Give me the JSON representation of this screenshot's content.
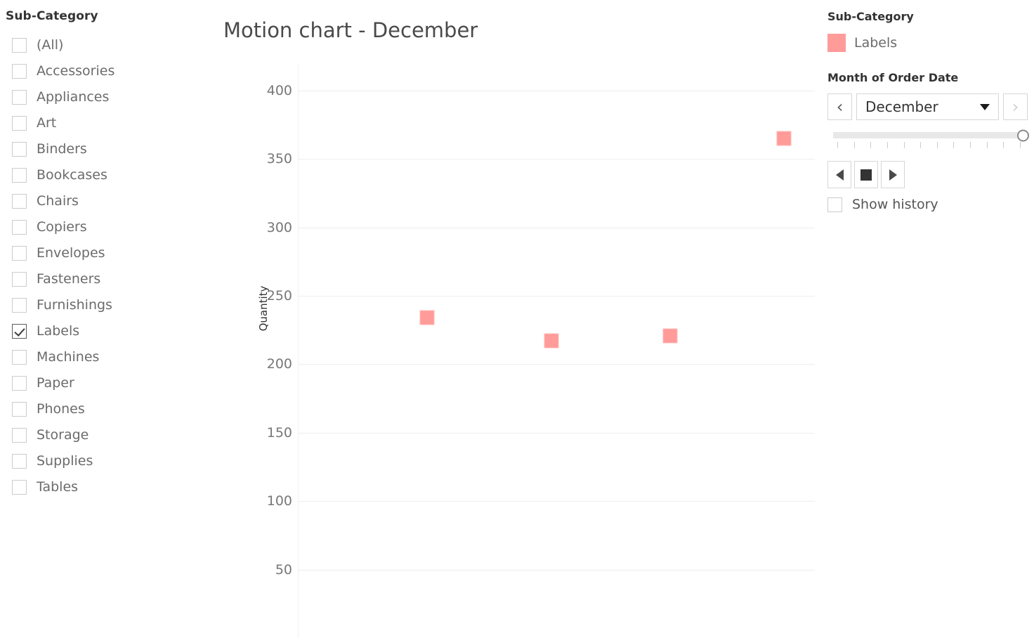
{
  "sidebar": {
    "title": "Sub-Category",
    "items": [
      {
        "label": "(All)",
        "checked": false
      },
      {
        "label": "Accessories",
        "checked": false
      },
      {
        "label": "Appliances",
        "checked": false
      },
      {
        "label": "Art",
        "checked": false
      },
      {
        "label": "Binders",
        "checked": false
      },
      {
        "label": "Bookcases",
        "checked": false
      },
      {
        "label": "Chairs",
        "checked": false
      },
      {
        "label": "Copiers",
        "checked": false
      },
      {
        "label": "Envelopes",
        "checked": false
      },
      {
        "label": "Fasteners",
        "checked": false
      },
      {
        "label": "Furnishings",
        "checked": false
      },
      {
        "label": "Labels",
        "checked": true
      },
      {
        "label": "Machines",
        "checked": false
      },
      {
        "label": "Paper",
        "checked": false
      },
      {
        "label": "Phones",
        "checked": false
      },
      {
        "label": "Storage",
        "checked": false
      },
      {
        "label": "Supplies",
        "checked": false
      },
      {
        "label": "Tables",
        "checked": false
      }
    ]
  },
  "chart_data": {
    "type": "scatter",
    "title": "Motion chart - December",
    "xlabel": "",
    "ylabel": "Quantity",
    "ylim": [
      0,
      420
    ],
    "yticks": [
      400,
      350,
      300,
      250,
      200,
      150,
      100,
      50
    ],
    "grid": true,
    "legend_position": "right",
    "mark_shape": "square",
    "mark_color": "#ff9b99",
    "series": [
      {
        "name": "Labels",
        "color": "#ff9b99",
        "points": [
          {
            "x": 0.25,
            "y": 234
          },
          {
            "x": 0.49,
            "y": 217
          },
          {
            "x": 0.72,
            "y": 221
          },
          {
            "x": 0.94,
            "y": 365
          }
        ]
      }
    ]
  },
  "right_panel": {
    "legend_title": "Sub-Category",
    "legend_items": [
      {
        "label": "Labels",
        "color": "#ff9b99"
      }
    ],
    "month_title": "Month of Order Date",
    "month_prev": "‹",
    "month_next": "›",
    "month_value": "December",
    "slider": {
      "ticks": 12,
      "value": 12
    },
    "playback": {
      "step_back": "step-back",
      "stop": "stop",
      "play": "play"
    },
    "show_history": {
      "label": "Show history",
      "checked": false
    }
  }
}
